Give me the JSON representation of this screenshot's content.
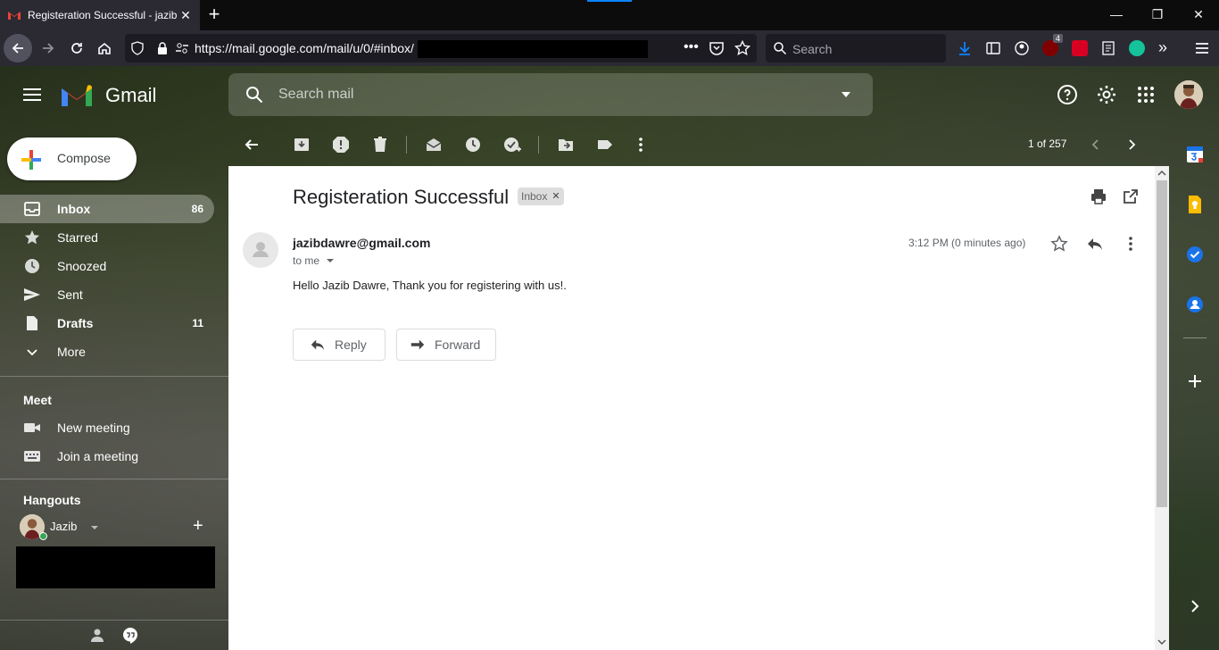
{
  "browser": {
    "tab_title": "Registeration Successful - jazib",
    "new_tab": "+",
    "url": "https://mail.google.com/mail/u/0/#inbox/",
    "search_placeholder": "Search",
    "ublock_badge": "4",
    "window_controls": [
      "—",
      "❐",
      "✕"
    ]
  },
  "gmail": {
    "brand": "Gmail",
    "search_placeholder": "Search mail",
    "compose_label": "Compose",
    "nav": [
      {
        "label": "Inbox",
        "count": "86",
        "icon": "inbox-icon",
        "active": true
      },
      {
        "label": "Starred",
        "count": "",
        "icon": "star-icon"
      },
      {
        "label": "Snoozed",
        "count": "",
        "icon": "clock-icon"
      },
      {
        "label": "Sent",
        "count": "",
        "icon": "send-icon"
      },
      {
        "label": "Drafts",
        "count": "11",
        "icon": "draft-icon"
      },
      {
        "label": "More",
        "count": "",
        "icon": "chevron-down-icon"
      }
    ],
    "meet": {
      "title": "Meet",
      "new_meeting": "New meeting",
      "join_meeting": "Join a meeting"
    },
    "hangouts": {
      "title": "Hangouts",
      "user": "Jazib"
    },
    "pager": "1 of 257"
  },
  "message": {
    "subject": "Registeration Successful",
    "label": "Inbox",
    "sender": "jazibdawre@gmail.com",
    "to": "to me",
    "time": "3:12 PM (0 minutes ago)",
    "body": "Hello Jazib Dawre, Thank you for registering with us!.",
    "reply_label": "Reply",
    "forward_label": "Forward"
  },
  "colors": {
    "accent_blue": "#1a73e8",
    "gmail_red": "#ea4335",
    "firefox_tab_accent": "#0a84ff"
  }
}
